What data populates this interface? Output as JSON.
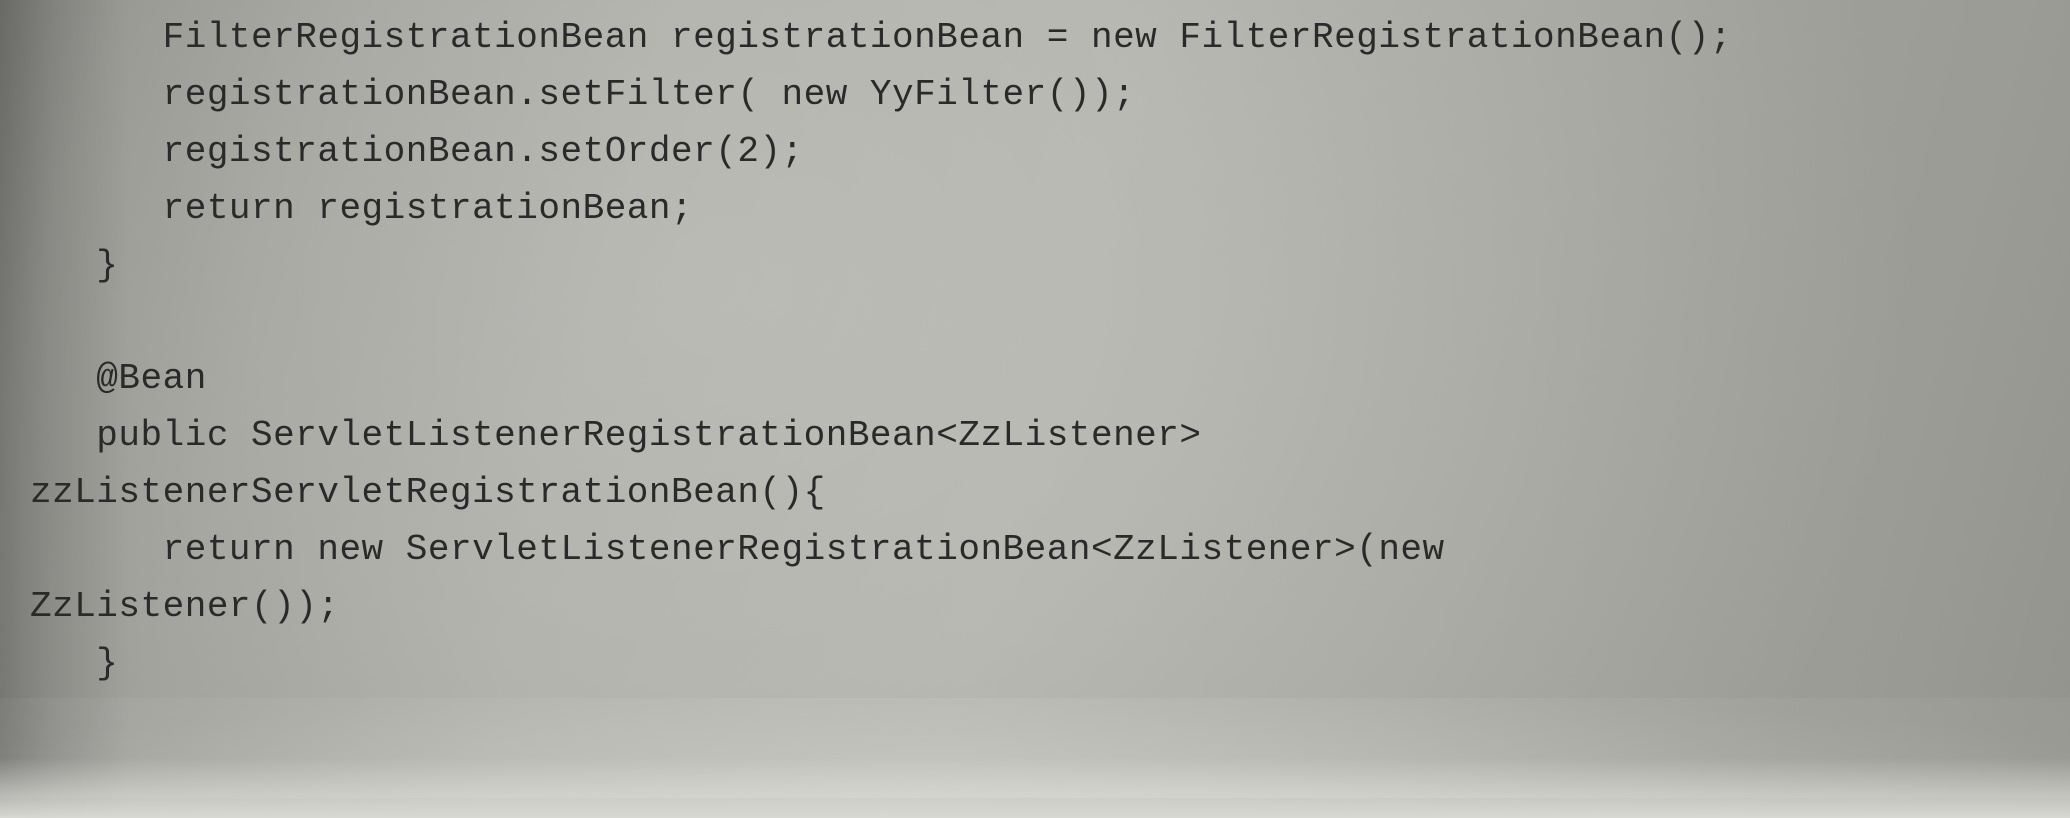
{
  "code": {
    "line1": "      FilterRegistrationBean registrationBean = new FilterRegistrationBean();",
    "line2": "      registrationBean.setFilter( new YyFilter());",
    "line3": "      registrationBean.setOrder(2);",
    "line4": "      return registrationBean;",
    "line5": "   }",
    "line6": "",
    "line7": "   @Bean",
    "line8": "   public ServletListenerRegistrationBean<ZzListener>",
    "line9": "zzListenerServletRegistrationBean(){",
    "line10": "      return new ServletListenerRegistrationBean<ZzListener>(new",
    "line11": "ZzListener());",
    "line12": "   }"
  },
  "watermark": ""
}
